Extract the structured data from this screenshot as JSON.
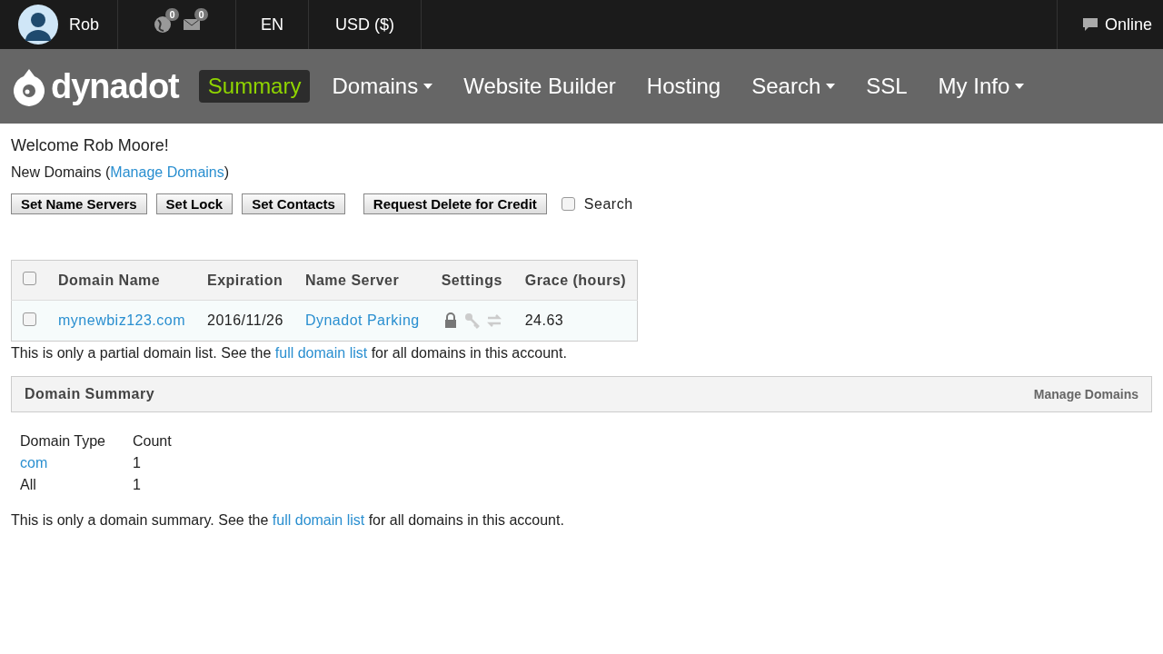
{
  "top_bar": {
    "user": "Rob",
    "notifications": [
      {
        "kind": "globe",
        "count": "0"
      },
      {
        "kind": "mail",
        "count": "0"
      }
    ],
    "language": "EN",
    "currency": "USD ($)",
    "status": "Online"
  },
  "nav": {
    "logo": "dynadot",
    "items": [
      {
        "label": "Summary",
        "selected": true,
        "dropdown": false
      },
      {
        "label": "Domains",
        "selected": false,
        "dropdown": true
      },
      {
        "label": "Website Builder",
        "selected": false,
        "dropdown": false
      },
      {
        "label": "Hosting",
        "selected": false,
        "dropdown": false
      },
      {
        "label": "Search",
        "selected": false,
        "dropdown": true
      },
      {
        "label": "SSL",
        "selected": false,
        "dropdown": false
      },
      {
        "label": "My Info",
        "selected": false,
        "dropdown": true
      }
    ]
  },
  "welcome": "Welcome Rob Moore!",
  "new_domains": {
    "label": "New Domains (",
    "link": "Manage Domains",
    "end": ")"
  },
  "actions": [
    "Set Name Servers",
    "Set Lock",
    "Set Contacts",
    "Request Delete for Credit"
  ],
  "search_toggle": {
    "label": "Search",
    "checked": false
  },
  "domain_table": {
    "select_all": false,
    "columns": [
      "Domain Name",
      "Expiration",
      "Name Server",
      "Settings",
      "Grace (hours)"
    ],
    "rows": [
      {
        "checked": false,
        "domain": "mynewbiz123.com",
        "expiration": "2016/11/26",
        "name_server": "Dynadot Parking",
        "settings": [
          {
            "kind": "lock",
            "on": true
          },
          {
            "kind": "key",
            "on": false
          },
          {
            "kind": "transfer",
            "on": false
          }
        ],
        "grace": "24.63"
      }
    ]
  },
  "partial_note": {
    "before": "This is only a partial domain list. See the ",
    "link": "full domain list",
    "after": " for all domains in this account."
  },
  "summary_panel": {
    "title": "Domain Summary",
    "link": "Manage Domains",
    "columns": [
      "Domain Type",
      "Count"
    ],
    "rows": [
      {
        "type": "com",
        "count": "1",
        "link": true
      },
      {
        "type": "All",
        "count": "1",
        "link": false
      }
    ]
  },
  "summary_note": {
    "before": "This is only a domain summary. See the ",
    "link": "full domain list",
    "after": " for all domains in this account."
  }
}
